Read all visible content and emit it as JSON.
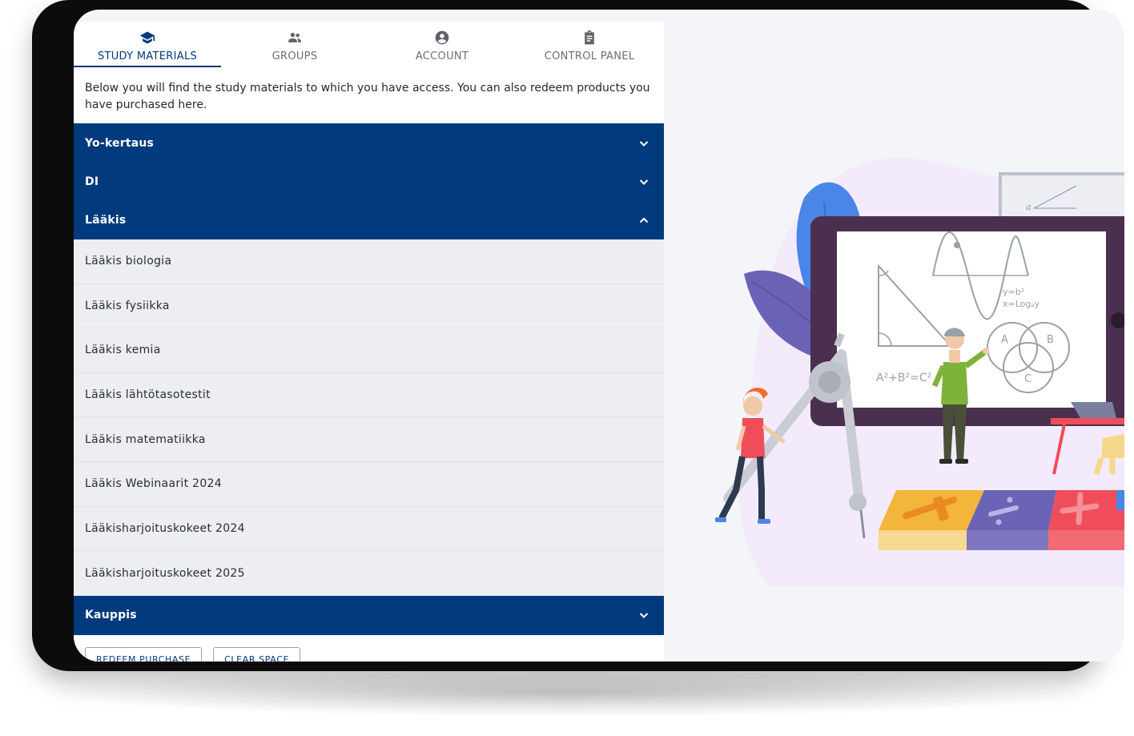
{
  "tabs": [
    {
      "label": "STUDY MATERIALS",
      "icon": "graduation-cap-icon"
    },
    {
      "label": "GROUPS",
      "icon": "people-icon"
    },
    {
      "label": "ACCOUNT",
      "icon": "account-circle-icon"
    },
    {
      "label": "CONTROL PANEL",
      "icon": "clipboard-icon"
    }
  ],
  "intro": "Below you will find the study materials to which you have access. You can also redeem products you have purchased here.",
  "accordion": {
    "yo_kertaus": "Yo-kertaus",
    "di": "DI",
    "laakis": "Lääkis",
    "kauppis": "Kauppis"
  },
  "laakis_items": [
    "Lääkis biologia",
    "Lääkis fysiikka",
    "Lääkis kemia",
    "Lääkis lähtötasotestit",
    "Lääkis matematiikka",
    "Lääkis Webinaarit 2024",
    "Lääkisharjoituskokeet 2024",
    "Lääkisharjoituskokeet 2025"
  ],
  "buttons": {
    "redeem": "REDEEM PURCHASE",
    "clear": "CLEAR SPACE"
  },
  "board": {
    "eq1": "y=b²",
    "eq2": "x=Logₐy",
    "pythag": "A²+B²=C²",
    "venn_a": "A",
    "venn_b": "B",
    "venn_c": "C",
    "small_a": "a"
  },
  "colors": {
    "primary": "#013a7d",
    "item_bg": "#eceef2",
    "device": "#0c0c0d"
  }
}
